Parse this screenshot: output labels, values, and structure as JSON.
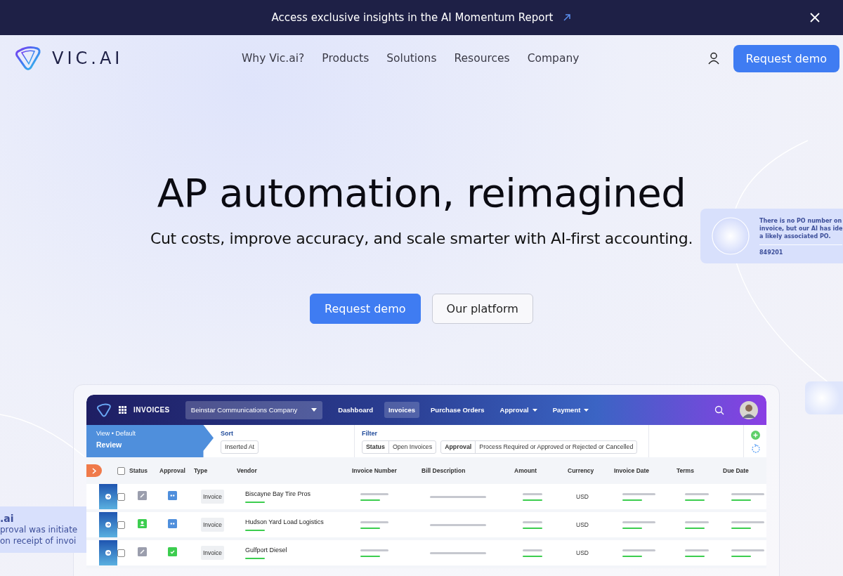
{
  "banner": {
    "text": "Access exclusive insights in the AI Momentum Report"
  },
  "nav": {
    "logo": "VIC.AI",
    "links": [
      "Why Vic.ai?",
      "Products",
      "Solutions",
      "Resources",
      "Company"
    ],
    "cta": "Request demo"
  },
  "hero": {
    "title": "AP automation, reimagined",
    "subtitle": "Cut costs, improve accuracy, and scale smarter with AI-first accounting.",
    "buttons": [
      {
        "label": "Request demo",
        "kind": "primary"
      },
      {
        "label": "Our platform",
        "kind": "secondary"
      }
    ]
  },
  "side_cards": {
    "right": {
      "lines": [
        "There is no PO number on",
        "invoice, but our AI has ide",
        "a likely associated PO."
      ],
      "code": "849201"
    },
    "left": {
      "title": ".ai",
      "lines": [
        "proval was initiate",
        "on receipt of invoi"
      ]
    }
  },
  "app": {
    "title": "INVOICES",
    "company": "Beinstar Communications Company",
    "menu": [
      {
        "label": "Dashboard",
        "selected": false,
        "dropdown": false
      },
      {
        "label": "Invoices",
        "selected": true,
        "dropdown": false
      },
      {
        "label": "Purchase Orders",
        "selected": false,
        "dropdown": false
      },
      {
        "label": "Approval",
        "selected": false,
        "dropdown": true
      },
      {
        "label": "Payment",
        "selected": false,
        "dropdown": true
      }
    ],
    "view": {
      "label": "View • Default",
      "name": "Review"
    },
    "sort": {
      "label": "Sort",
      "value": "Inserted At"
    },
    "filter": {
      "label": "Filter",
      "chips": [
        {
          "key": "Status",
          "value": "Open Invoices"
        },
        {
          "key": "Approval",
          "value": "Process Required or Approved or Rejected or Cancelled"
        }
      ]
    },
    "columns": [
      "Status",
      "Approval",
      "Type",
      "Vendor",
      "Invoice Number",
      "Bill Description",
      "Amount",
      "Currency",
      "Invoice Date",
      "Terms",
      "Due Date"
    ],
    "header_checked": false,
    "rows": [
      {
        "checked": false,
        "status_icon": {
          "kind": "edit"
        },
        "approval_icon": {
          "kind": "pending"
        },
        "type": "Invoice",
        "vendor": "Biscayne Bay Tire Pros",
        "currency": "USD"
      },
      {
        "checked": false,
        "status_icon": {
          "kind": "user"
        },
        "approval_icon": {
          "kind": "pending"
        },
        "type": "Invoice",
        "vendor": "Hudson Yard Load Logistics",
        "currency": "USD"
      },
      {
        "checked": false,
        "status_icon": {
          "kind": "edit"
        },
        "approval_icon": {
          "kind": "approved"
        },
        "type": "Invoice",
        "vendor": "Gulfport Diesel",
        "currency": "USD"
      }
    ]
  }
}
